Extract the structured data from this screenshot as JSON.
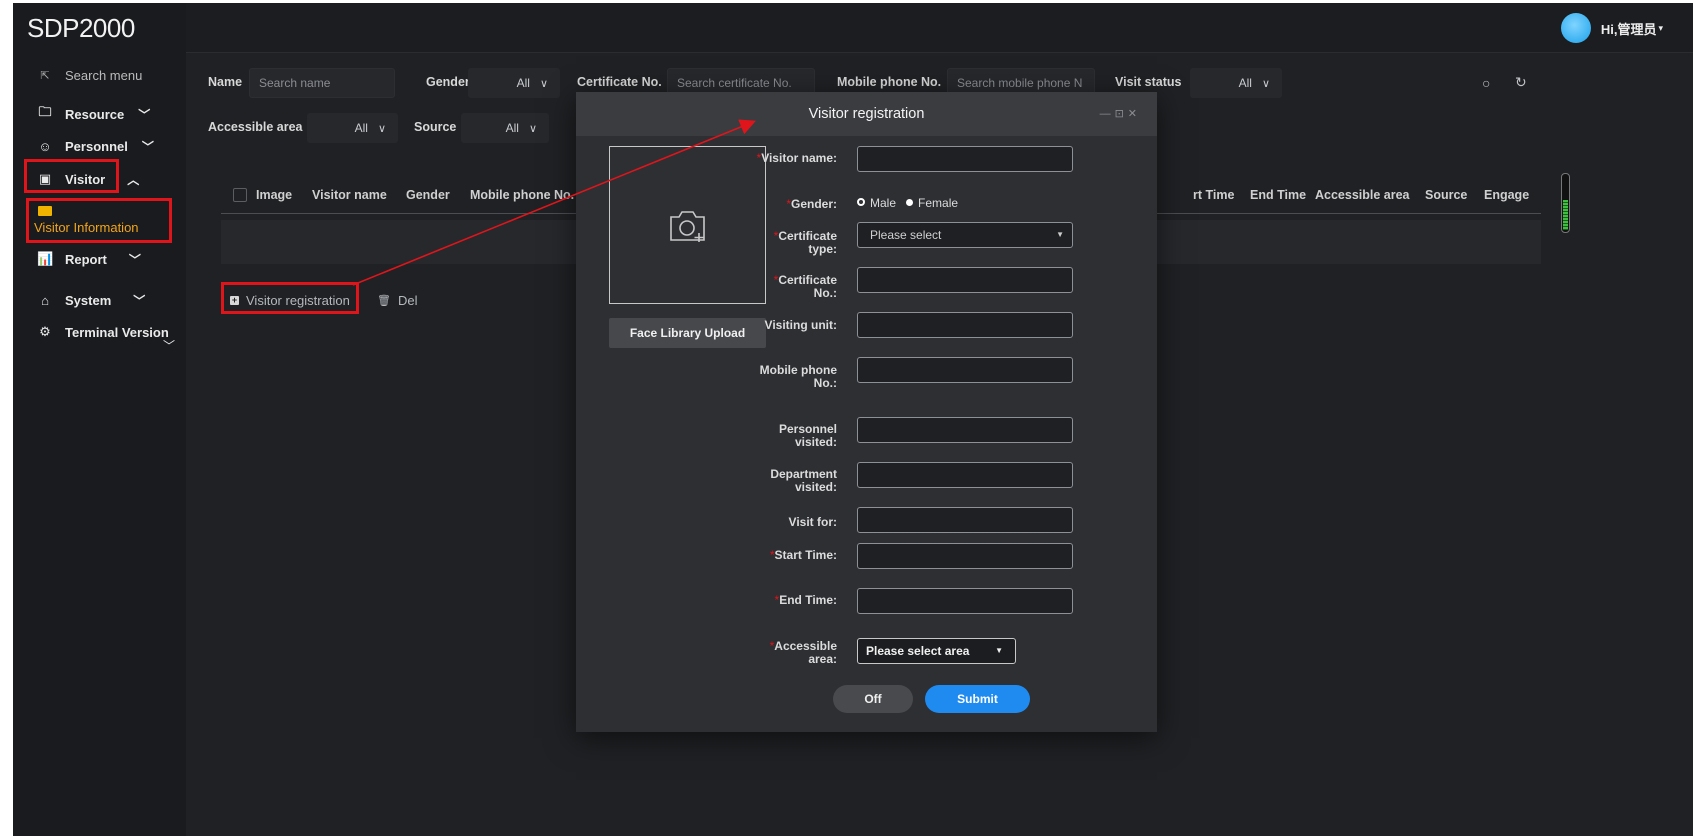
{
  "app": {
    "brand": "SDP2000",
    "user_greeting": "Hi,管理员"
  },
  "sidebar": {
    "search": "Search menu",
    "items": [
      {
        "label": "Resource",
        "icon": "folder-icon"
      },
      {
        "label": "Personnel",
        "icon": "personnel-icon"
      },
      {
        "label": "Visitor",
        "icon": "visitor-icon"
      },
      {
        "label": "Report",
        "icon": "chart-icon"
      },
      {
        "label": "System",
        "icon": "home-icon"
      },
      {
        "label": "Terminal Version",
        "icon": "gears-icon"
      }
    ],
    "visitor_sub": "Visitor Information"
  },
  "filters": {
    "name_label": "Name",
    "name_placeholder": "Search name",
    "gender_label": "Gender",
    "gender_value": "All",
    "cert_label": "Certificate No.",
    "cert_placeholder": "Search certificate No.",
    "phone_label": "Mobile phone No.",
    "phone_placeholder": "Search mobile phone N",
    "status_label": "Visit status",
    "status_value": "All",
    "area_label": "Accessible area",
    "area_value": "All",
    "source_label": "Source",
    "source_value": "All"
  },
  "table": {
    "columns_left": [
      "Image",
      "Visitor name",
      "Gender",
      "Mobile phone No."
    ],
    "columns_right": [
      "rt Time",
      "End Time",
      "Accessible area",
      "Source",
      "Engage"
    ]
  },
  "actions": {
    "register": "Visitor registration",
    "delete": "Del"
  },
  "modal": {
    "title": "Visitor registration",
    "upload": "Face Library Upload",
    "labels": {
      "visitor_name": "Visitor name:",
      "gender": "Gender:",
      "cert_type": "Certificate type:",
      "cert_no": "Certificate No.:",
      "visiting_unit": "Visiting unit:",
      "mobile": "Mobile phone No.:",
      "personnel": "Personnel visited:",
      "department": "Department visited:",
      "visit_for": "Visit for:",
      "start_time": "Start Time:",
      "end_time": "End Time:",
      "accessible_area": "Accessible area:"
    },
    "gender_options": [
      "Male",
      "Female"
    ],
    "cert_type_placeholder": "Please select",
    "area_placeholder": "Please select area",
    "off": "Off",
    "submit": "Submit"
  },
  "colors": {
    "accent": "#1f8bf0",
    "highlight": "#e0151b",
    "active_menu": "#f2a51a"
  }
}
